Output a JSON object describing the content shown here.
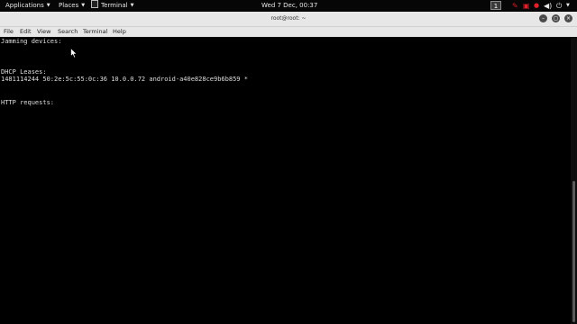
{
  "topbar": {
    "applications_label": "Applications",
    "places_label": "Places",
    "terminal_label": "Terminal",
    "clock": "Wed  7 Dec, 00:37",
    "workspace": "1"
  },
  "window": {
    "title": "root@root: ~"
  },
  "menu": {
    "items": [
      "File",
      "Edit",
      "View",
      "Search",
      "Terminal",
      "Help"
    ]
  },
  "terminal": {
    "lines": [
      "Jamming devices:",
      "DHCP Leases:",
      "1481114244 50:2e:5c:55:0c:36 10.0.0.72 android-a40e828ce9b6b859 *",
      "HTTP requests:"
    ]
  },
  "colors": {
    "topbar_bg": "#060606",
    "titlebar_bg": "#e7e7e7",
    "terminal_bg": "#000000",
    "terminal_fg": "#dedede",
    "tray_red": "#e0202a"
  }
}
